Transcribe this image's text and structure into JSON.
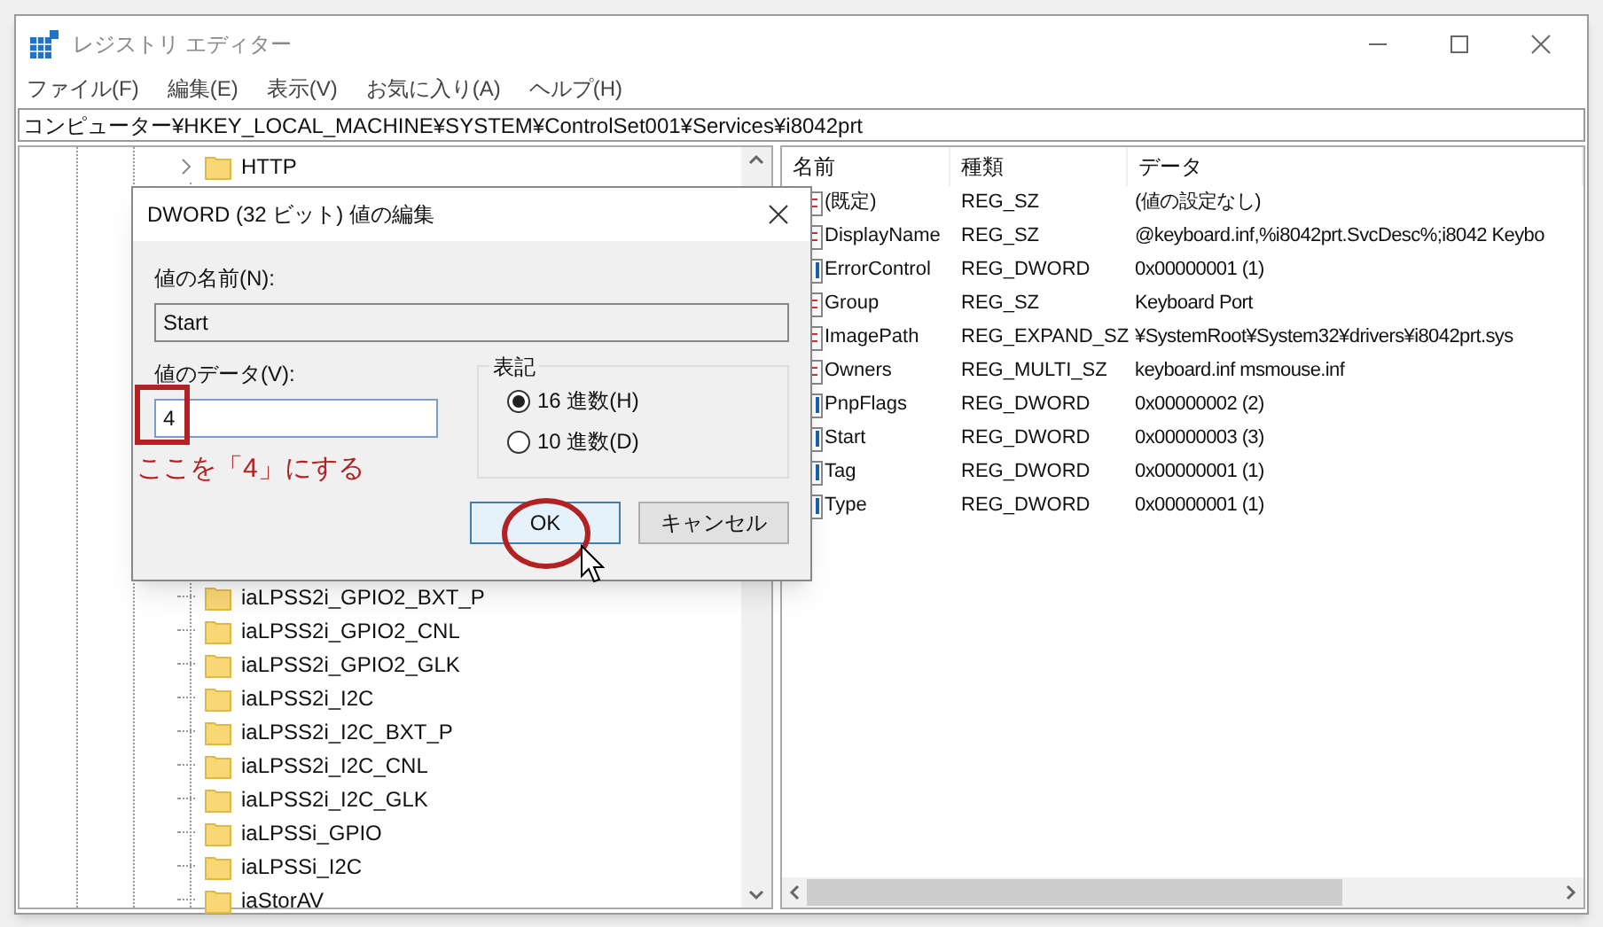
{
  "window": {
    "title": "レジストリ エディター"
  },
  "menu": [
    "ファイル(F)",
    "編集(E)",
    "表示(V)",
    "お気に入り(A)",
    "ヘルプ(H)"
  ],
  "address": "コンピューター¥HKEY_LOCAL_MACHINE¥SYSTEM¥ControlSet001¥Services¥i8042prt",
  "tree": {
    "items": [
      {
        "label": "HTTP",
        "kind": "expandable"
      },
      {
        "label": "iaLPSS2i_GPIO2_BXT_P",
        "kind": "leaf"
      },
      {
        "label": "iaLPSS2i_GPIO2_CNL",
        "kind": "leaf"
      },
      {
        "label": "iaLPSS2i_GPIO2_GLK",
        "kind": "leaf"
      },
      {
        "label": "iaLPSS2i_I2C",
        "kind": "leaf"
      },
      {
        "label": "iaLPSS2i_I2C_BXT_P",
        "kind": "leaf"
      },
      {
        "label": "iaLPSS2i_I2C_CNL",
        "kind": "leaf"
      },
      {
        "label": "iaLPSS2i_I2C_GLK",
        "kind": "leaf"
      },
      {
        "label": "iaLPSSi_GPIO",
        "kind": "leaf"
      },
      {
        "label": "iaLPSSi_I2C",
        "kind": "leaf"
      },
      {
        "label": "iaStorAV",
        "kind": "leaf"
      }
    ]
  },
  "values": {
    "columns": [
      "名前",
      "種類",
      "データ"
    ],
    "rows": [
      {
        "kind": "string",
        "name": "(既定)",
        "type": "REG_SZ",
        "data": "(値の設定なし)"
      },
      {
        "kind": "string",
        "name": "DisplayName",
        "type": "REG_SZ",
        "data": "@keyboard.inf,%i8042prt.SvcDesc%;i8042 Keybo"
      },
      {
        "kind": "binary",
        "name": "ErrorControl",
        "type": "REG_DWORD",
        "data": "0x00000001 (1)"
      },
      {
        "kind": "string",
        "name": "Group",
        "type": "REG_SZ",
        "data": "Keyboard Port"
      },
      {
        "kind": "string",
        "name": "ImagePath",
        "type": "REG_EXPAND_SZ",
        "data": "¥SystemRoot¥System32¥drivers¥i8042prt.sys"
      },
      {
        "kind": "string",
        "name": "Owners",
        "type": "REG_MULTI_SZ",
        "data": "keyboard.inf msmouse.inf"
      },
      {
        "kind": "binary",
        "name": "PnpFlags",
        "type": "REG_DWORD",
        "data": "0x00000002 (2)"
      },
      {
        "kind": "binary",
        "name": "Start",
        "type": "REG_DWORD",
        "data": "0x00000003 (3)"
      },
      {
        "kind": "binary",
        "name": "Tag",
        "type": "REG_DWORD",
        "data": "0x00000001 (1)"
      },
      {
        "kind": "binary",
        "name": "Type",
        "type": "REG_DWORD",
        "data": "0x00000001 (1)"
      }
    ]
  },
  "dialog": {
    "title": "DWORD (32 ビット) 値の編集",
    "name_label": "値の名前(N):",
    "name_value": "Start",
    "data_label": "値のデータ(V):",
    "data_value": "4",
    "base_group": "表記",
    "base_options": [
      {
        "label": "16 進数(H)",
        "selected": true
      },
      {
        "label": "10 進数(D)",
        "selected": false
      }
    ],
    "buttons": [
      {
        "label": "OK",
        "default": true
      },
      {
        "label": "キャンセル",
        "default": false
      }
    ]
  },
  "annotation": {
    "note": "ここを「4」にする"
  }
}
